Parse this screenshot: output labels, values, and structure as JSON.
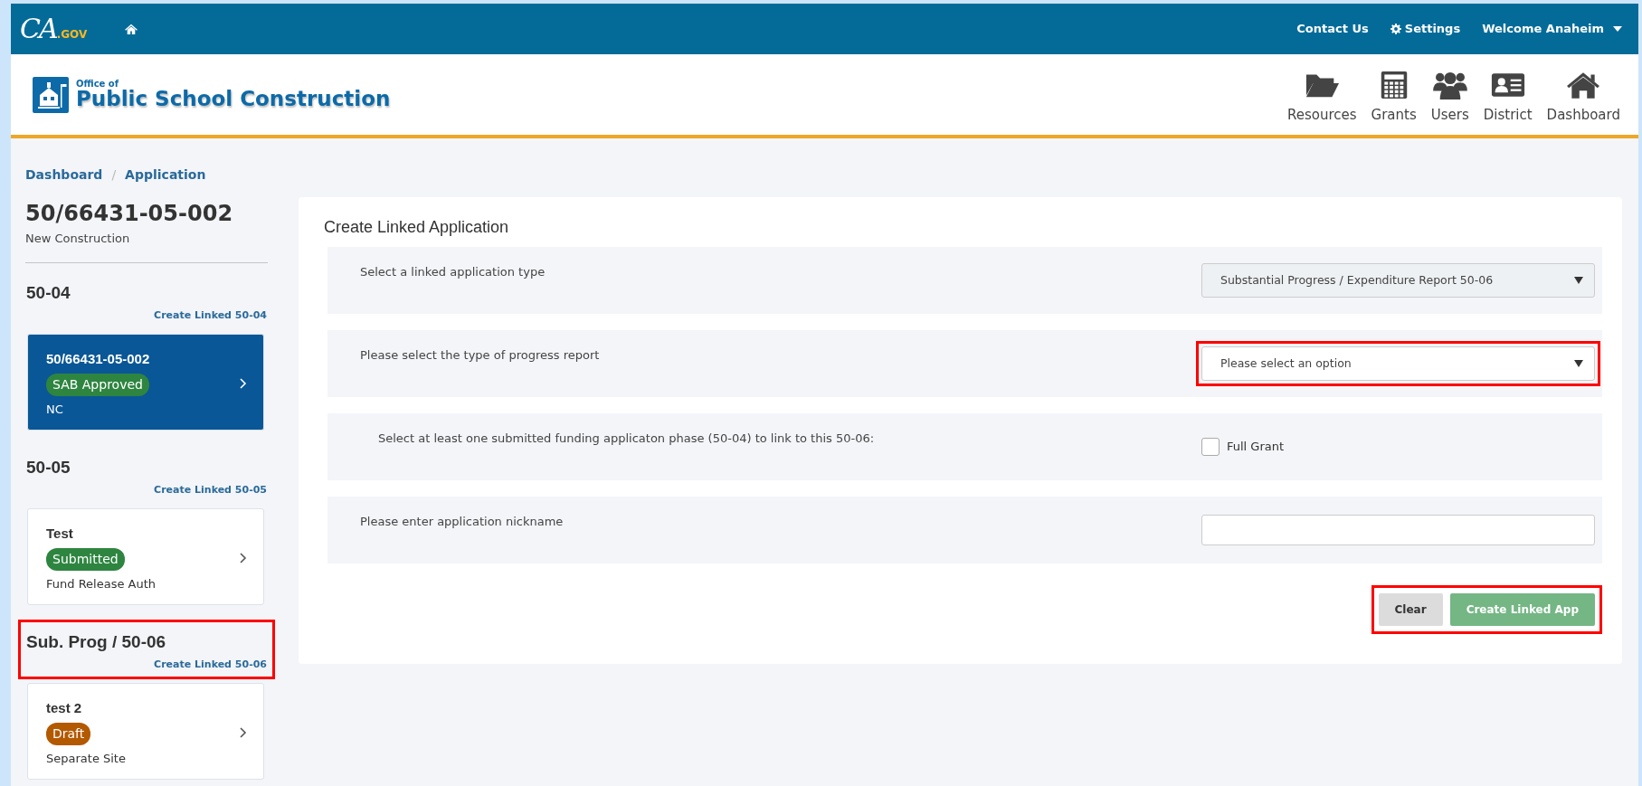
{
  "topbar": {
    "logo": "CA",
    "logo_suffix": ".GOV",
    "links": [
      {
        "label": "Contact Us",
        "kind": "plain"
      },
      {
        "label": "Settings",
        "kind": "settings"
      },
      {
        "label": "Welcome Anaheim",
        "kind": "dropdown"
      }
    ]
  },
  "header": {
    "brand_small": "Office of",
    "brand_large": "Public School Construction",
    "nav": [
      {
        "label": "Resources",
        "kind": "folder"
      },
      {
        "label": "Grants",
        "kind": "calculator"
      },
      {
        "label": "Users",
        "kind": "users"
      },
      {
        "label": "District",
        "kind": "card"
      },
      {
        "label": "Dashboard",
        "kind": "home"
      }
    ]
  },
  "breadcrumb": {
    "items": [
      "Dashboard",
      "Application"
    ],
    "separator": "/"
  },
  "application": {
    "number": "50/66431-05-002",
    "type": "New Construction"
  },
  "sections": [
    {
      "title": "50-04",
      "link": "Create Linked 50-04",
      "highlighted": false,
      "cards": [
        {
          "name": "50/66431-05-002",
          "status": "SAB Approved",
          "color": "#2e8540",
          "subtitle": "NC",
          "selected": true
        }
      ]
    },
    {
      "title": "50-05",
      "link": "Create Linked 50-05",
      "highlighted": false,
      "cards": [
        {
          "name": "Test",
          "status": "Submitted",
          "color": "#2e8540",
          "subtitle": "Fund Release Auth",
          "selected": false
        }
      ]
    },
    {
      "title": "Sub. Prog / 50-06",
      "link": "Create Linked 50-06",
      "highlighted": true,
      "cards": [
        {
          "name": "test 2",
          "status": "Draft",
          "color": "#b35900",
          "subtitle": "Separate Site",
          "selected": false
        }
      ]
    }
  ],
  "form": {
    "title": "Create Linked Application",
    "rows": [
      {
        "kind": "select",
        "label": "Select a linked application type",
        "value": "Substantial Progress / Expenditure Report 50-06",
        "disabled": true,
        "highlighted": false
      },
      {
        "kind": "select",
        "label": "Please select the type of progress report",
        "value": "Please select an option",
        "disabled": false,
        "highlighted": true
      },
      {
        "kind": "checkbox",
        "label": "Select at least one submitted funding applicaton phase (50-04) to link to this 50-06:",
        "option": "Full Grant",
        "checked": false
      },
      {
        "kind": "text",
        "label": "Please enter application nickname"
      }
    ],
    "buttons": [
      {
        "label": "Clear",
        "kind": "secondary",
        "disabled": false
      },
      {
        "label": "Create Linked App",
        "kind": "success",
        "disabled": true
      }
    ],
    "buttons_highlighted": true
  }
}
